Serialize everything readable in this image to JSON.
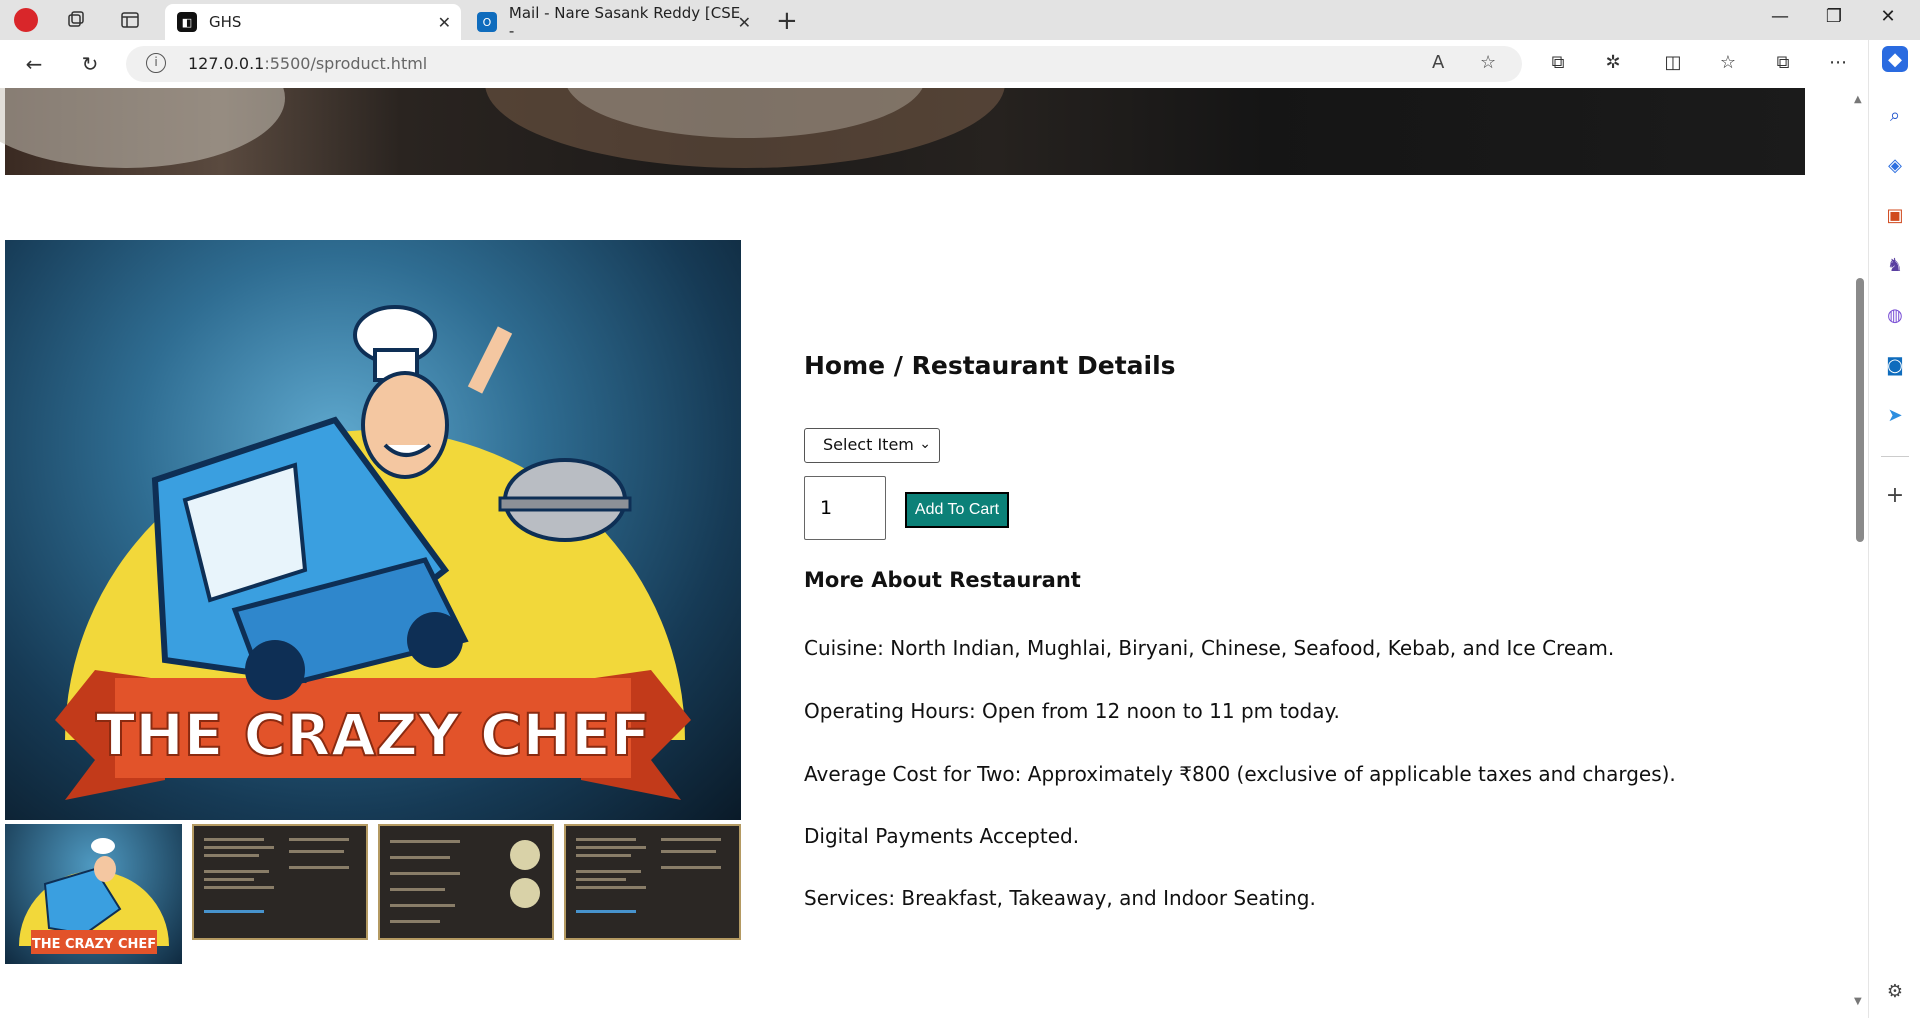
{
  "browser": {
    "tabs": [
      {
        "title": "GHS",
        "active": true
      },
      {
        "title": "Mail - Nare Sasank Reddy [CSE -",
        "active": false
      }
    ],
    "address": {
      "host": "127.0.0.1",
      "path": ":5500/sproduct.html"
    },
    "colors": {
      "accent": "#0c8178",
      "tab_active": "#ffffff",
      "strip": "#e3e3e3"
    }
  },
  "page": {
    "breadcrumb": "Home / Restaurant Details",
    "select": {
      "selected": "Select Item"
    },
    "quantity": "1",
    "add_to_cart": "Add To Cart",
    "more_heading": "More About Restaurant",
    "details": [
      "Cuisine: North Indian, Mughlai, Biryani, Chinese, Seafood, Kebab, and Ice Cream.",
      "Operating Hours: Open from 12 noon to 11 pm today.",
      "Average Cost for Two: Approximately ₹800 (exclusive of applicable taxes and charges).",
      "Digital Payments Accepted.",
      "Services: Breakfast, Takeaway, and Indoor Seating."
    ],
    "logo_text": "THE CRAZY CHEF",
    "thumbnail_logo_text": "THE CRAZY CHEF"
  }
}
